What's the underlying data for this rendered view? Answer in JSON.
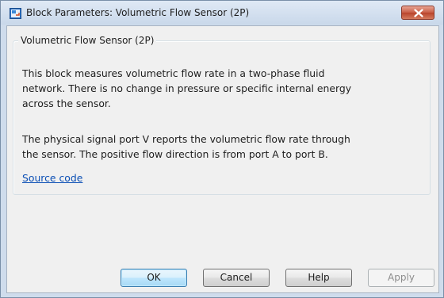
{
  "window": {
    "title": "Block Parameters: Volumetric Flow Sensor (2P)"
  },
  "group": {
    "title": "Volumetric Flow Sensor (2P)",
    "description_lines": [
      "This block measures volumetric flow rate in a two-phase fluid",
      "network. There is no change in pressure or specific internal energy",
      "across the sensor.",
      "The physical signal port V reports the volumetric flow rate through",
      "the sensor. The positive flow direction is from port A to port B."
    ],
    "source_link": "Source code"
  },
  "buttons": {
    "ok": "OK",
    "cancel": "Cancel",
    "help": "Help",
    "apply": "Apply"
  },
  "colors": {
    "title_bar": "#c9d8ea",
    "close_button": "#c75c44",
    "link": "#0b4fb5",
    "dialog_background": "#f0f0f0"
  },
  "icons": {
    "app_icon": "simulink-block-icon",
    "close_icon": "close-x-icon"
  }
}
